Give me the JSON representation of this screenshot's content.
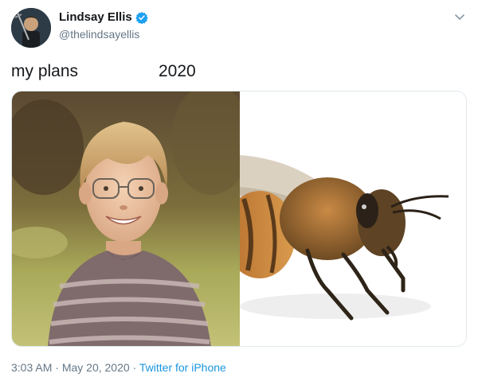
{
  "author": {
    "display_name": "Lindsay Ellis",
    "handle": "@thelindsayellis",
    "verified": true,
    "verified_color": "#1da1f2"
  },
  "tweet": {
    "text_left": "my plans",
    "text_right": "2020"
  },
  "media": {
    "left_image": "smiling-boy-photo",
    "right_image": "honeybee-photo"
  },
  "meta": {
    "time": "3:03 AM",
    "separator": "·",
    "date": "May 20, 2020",
    "source": "Twitter for iPhone",
    "source_color": "#1b95e0"
  },
  "icons": {
    "more": "chevron-down-icon",
    "verified": "verified-badge-icon"
  }
}
